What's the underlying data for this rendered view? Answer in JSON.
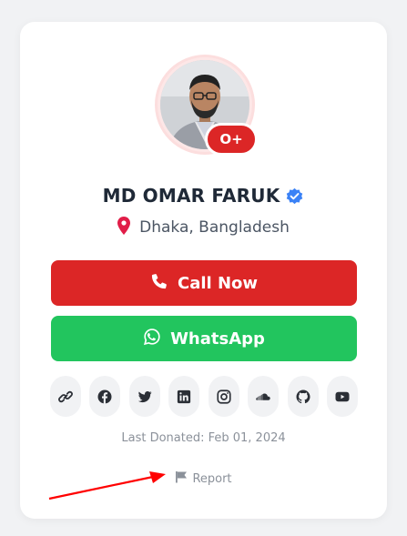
{
  "profile": {
    "name": "MD OMAR FARUK",
    "location": "Dhaka, Bangladesh",
    "blood_group": "O+",
    "verified": true
  },
  "actions": {
    "call_label": "Call Now",
    "whatsapp_label": "WhatsApp"
  },
  "socials": [
    {
      "icon": "link-icon"
    },
    {
      "icon": "facebook-icon"
    },
    {
      "icon": "twitter-icon"
    },
    {
      "icon": "linkedin-icon"
    },
    {
      "icon": "instagram-icon"
    },
    {
      "icon": "soundcloud-icon"
    },
    {
      "icon": "github-icon"
    },
    {
      "icon": "youtube-icon"
    }
  ],
  "footer": {
    "last_donated": "Last Donated: Feb 01, 2024",
    "report_label": "Report"
  },
  "colors": {
    "accent_red": "#dc2626",
    "whatsapp_green": "#22c55e",
    "verified_blue": "#3b82f6",
    "page_bg": "#f1f2f4"
  }
}
